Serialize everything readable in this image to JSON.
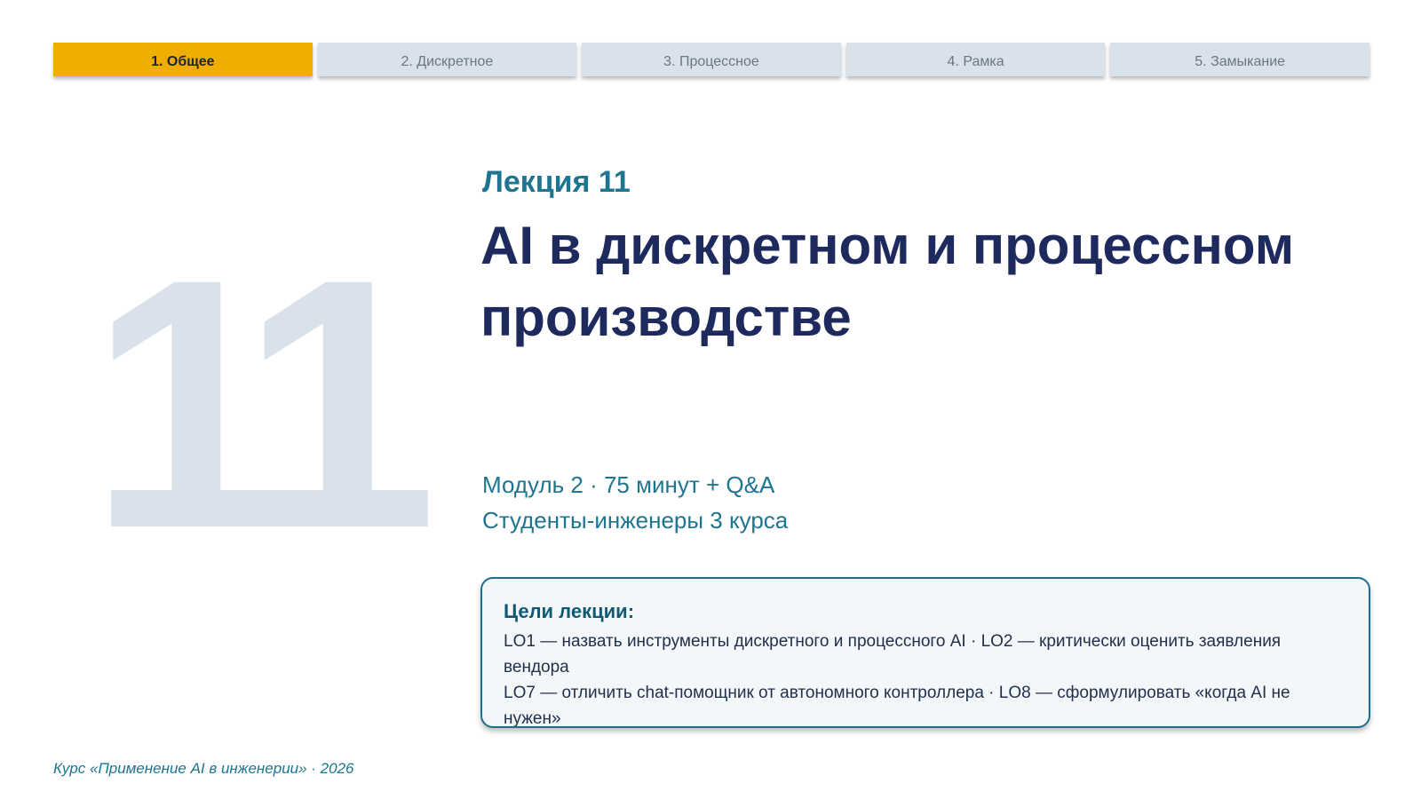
{
  "tabs": [
    {
      "label": "1. Общее",
      "active": true
    },
    {
      "label": "2. Дискретное",
      "active": false
    },
    {
      "label": "3. Процессное",
      "active": false
    },
    {
      "label": "4. Рамка",
      "active": false
    },
    {
      "label": "5. Замыкание",
      "active": false
    }
  ],
  "slide": {
    "big_number": "11",
    "kicker": "Лекция 11",
    "title": "AI в дискретном и процессном производстве",
    "meta_line_1": "Модуль 2 · 75 минут + Q&A",
    "meta_line_2": "Студенты-инженеры 3 курса"
  },
  "goals": {
    "title": "Цели лекции:",
    "line_1": "LO1 — назвать инструменты дискретного и процессного AI · LO2 — критически оценить заявления вендора",
    "line_2": "LO7 — отличить chat-помощник от автономного контроллера · LO8 — сформулировать «когда AI не нужен»"
  },
  "footer": {
    "text": "Курс «Применение AI в инженерии» · 2026"
  },
  "colors": {
    "accent_tab": "#efae00",
    "inactive_tab": "#d9e2ea",
    "title": "#1e2a5e",
    "teal": "#1d7590"
  }
}
